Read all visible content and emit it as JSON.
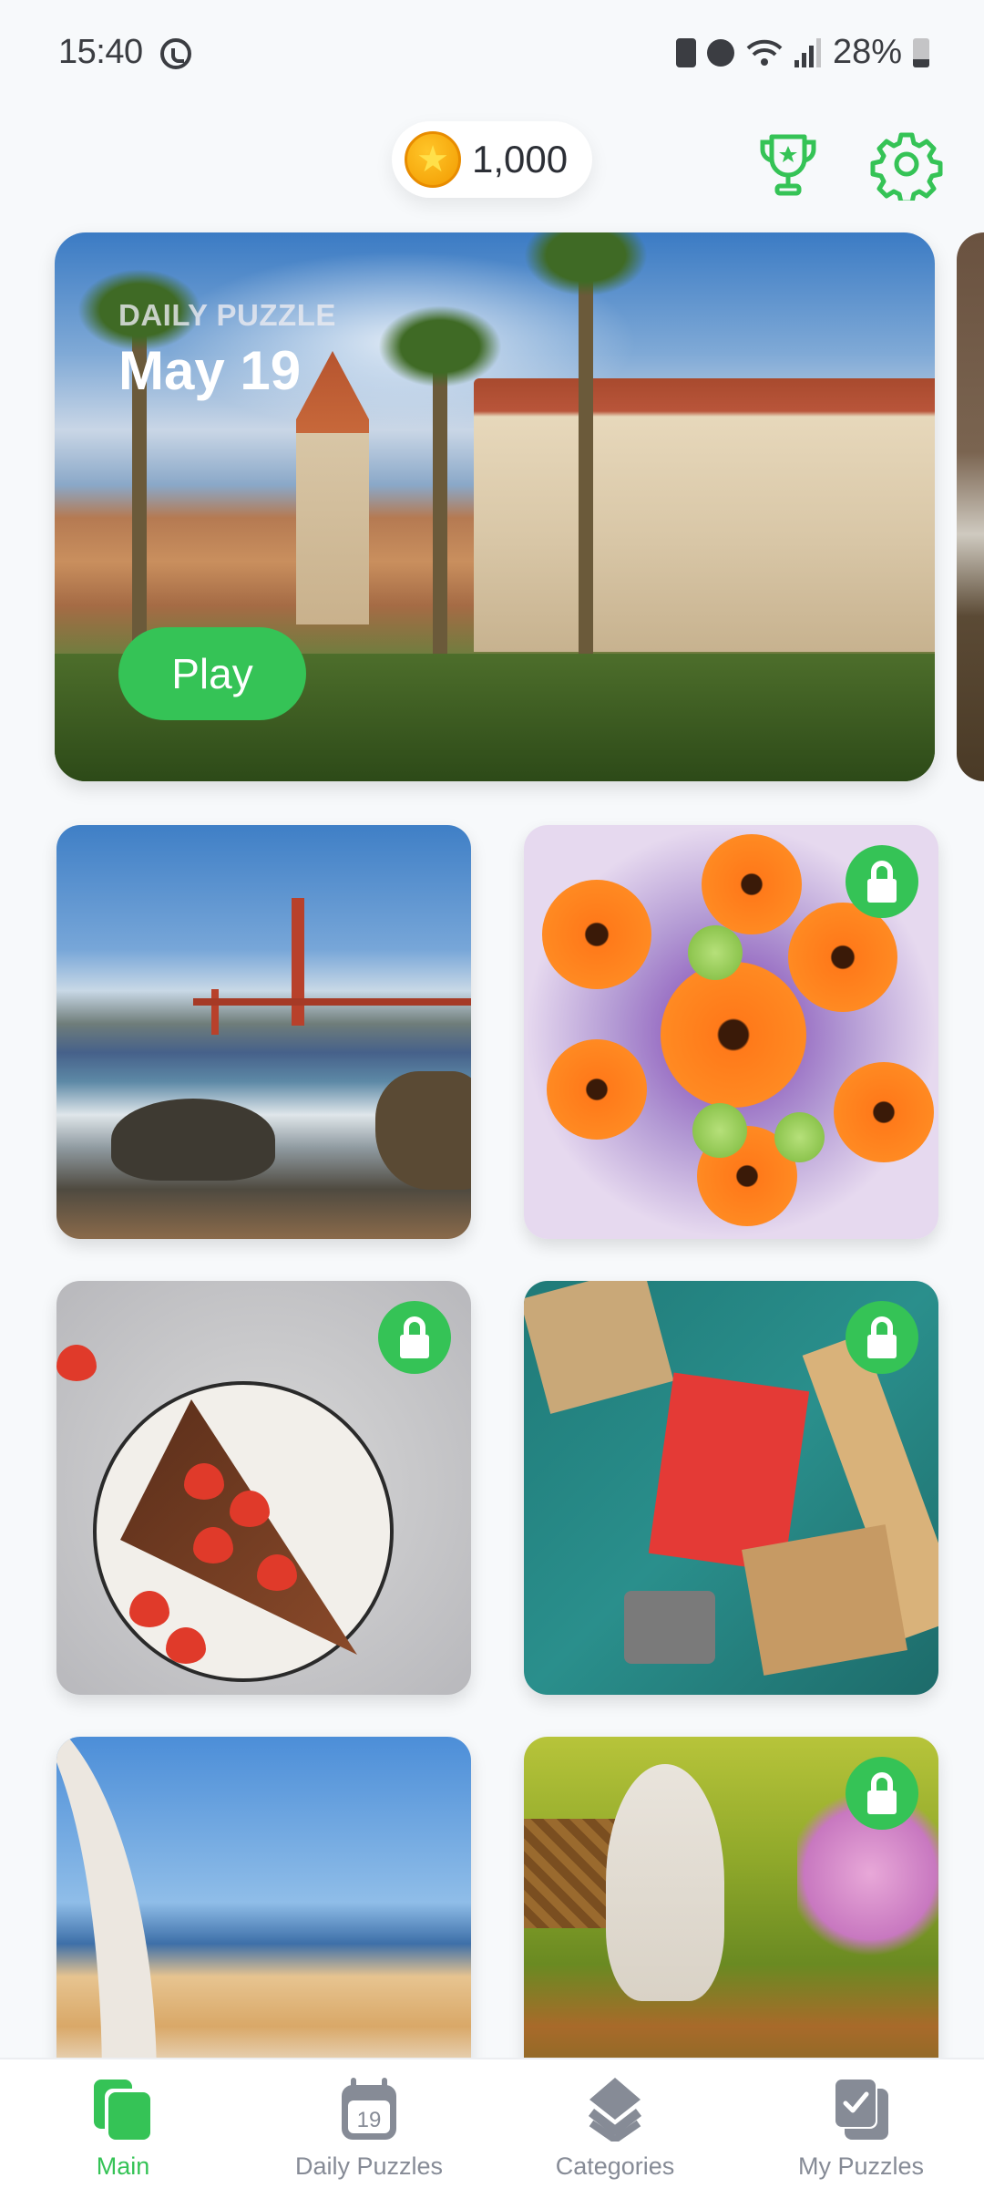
{
  "status_bar": {
    "time": "15:40",
    "notification_icons": [
      "whatsapp-icon"
    ],
    "system_icons": [
      "battery-saver-icon",
      "alarm-icon",
      "wifi-icon",
      "signal-icon"
    ],
    "battery_percent": "28%"
  },
  "header": {
    "coins": "1,000",
    "coin_icon": "star-coin-icon",
    "trophy_icon": "trophy-icon",
    "settings_icon": "gear-icon",
    "accent_color": "#35c356"
  },
  "daily_puzzle": {
    "label": "DAILY PUZZLE",
    "date": "May 19",
    "play_label": "Play",
    "image": "historic building with palm trees"
  },
  "puzzles": [
    {
      "image": "golden gate bridge and beach",
      "locked": false
    },
    {
      "image": "orange gerbera bouquet",
      "locked": true
    },
    {
      "image": "strawberry chocolate tart",
      "locked": true
    },
    {
      "image": "desk with notebooks and watch",
      "locked": true
    },
    {
      "image": "mediterranean terrace view",
      "locked": false
    },
    {
      "image": "kitten in basket with flowers",
      "locked": true
    }
  ],
  "nav": {
    "items": [
      {
        "label": "Main",
        "icon": "cards-icon",
        "active": true
      },
      {
        "label": "Daily Puzzles",
        "icon": "calendar-icon",
        "badge": "19",
        "active": false
      },
      {
        "label": "Categories",
        "icon": "layers-icon",
        "active": false
      },
      {
        "label": "My Puzzles",
        "icon": "check-cards-icon",
        "active": false
      }
    ]
  }
}
